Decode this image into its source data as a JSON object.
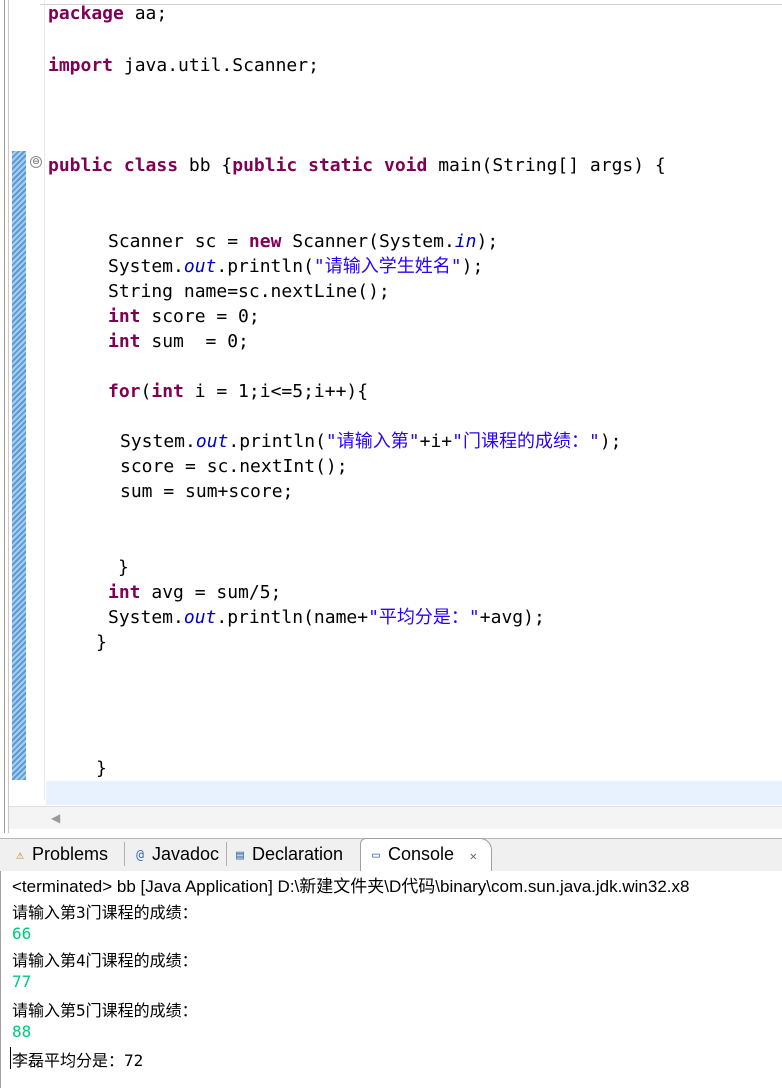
{
  "code": {
    "l1": {
      "kw": "package",
      "rest": " aa;"
    },
    "l2": {
      "kw": "import",
      "rest": " java.util.Scanner;"
    },
    "l3": {
      "kw1": "public",
      "sp1": " ",
      "kw2": "class",
      "mid": " bb {",
      "kw3": "public",
      "sp2": " ",
      "kw4": "static",
      "sp3": " ",
      "kw5": "void",
      "rest": " main(String[] args) {"
    },
    "l4": {
      "a": "Scanner sc = ",
      "kw": "new",
      "b": " Scanner(System.",
      "fld": "in",
      "c": ");"
    },
    "l5": {
      "a": "System.",
      "fld": "out",
      "b": ".println(",
      "str": "\"请输入学生姓名\"",
      "c": ");"
    },
    "l6": {
      "text": "String name=sc.nextLine();"
    },
    "l7": {
      "kw": "int",
      "rest": " score = 0;"
    },
    "l8": {
      "kw": "int",
      "rest": " sum  = 0;"
    },
    "l9": {
      "kw1": "for",
      "p": "(",
      "kw2": "int",
      "rest": " i = 1;i<=5;i++){"
    },
    "l10": {
      "a": "System.",
      "fld": "out",
      "b": ".println(",
      "str1": "\"请输入第\"",
      "m": "+i+",
      "str2": "\"门课程的成绩：\"",
      "c": ");"
    },
    "l11": {
      "text": "score = sc.nextInt();"
    },
    "l12": {
      "text": "sum = sum+score;"
    },
    "l13": {
      "text": "}"
    },
    "l14": {
      "kw": "int",
      "rest": " avg = sum/5;"
    },
    "l15": {
      "a": "System.",
      "fld": "out",
      "b": ".println(name+",
      "str": "\"平均分是：\"",
      "c": "+avg);"
    },
    "l16": {
      "text": "}"
    },
    "l17": {
      "text": "}"
    }
  },
  "fold_icon": "⊖",
  "scroll_left_arrow": "◀",
  "tabs": {
    "problems": {
      "icon": "problems-icon",
      "glyph": "⚠",
      "label": "Problems"
    },
    "javadoc": {
      "icon": "at-icon",
      "glyph": "@",
      "label": "Javadoc"
    },
    "declaration": {
      "icon": "declaration-icon",
      "glyph": "▤",
      "label": "Declaration"
    },
    "console": {
      "icon": "console-icon",
      "glyph": "▭",
      "label": "Console",
      "close": "✕"
    }
  },
  "console": {
    "header": "<terminated> bb [Java Application] D:\\新建文件夹\\D代码\\binary\\com.sun.java.jdk.win32.x8",
    "lines": [
      {
        "type": "out",
        "text": "请输入第3门课程的成绩："
      },
      {
        "type": "in",
        "text": "66"
      },
      {
        "type": "out",
        "text": "请输入第4门课程的成绩："
      },
      {
        "type": "in",
        "text": "77"
      },
      {
        "type": "out",
        "text": "请输入第5门课程的成绩："
      },
      {
        "type": "in",
        "text": "88"
      },
      {
        "type": "out",
        "text": "李磊平均分是：72"
      }
    ]
  },
  "colors": {
    "keyword": "#7f0055",
    "string": "#2a00ff",
    "field": "#0000c0",
    "input": "#00c87d"
  }
}
